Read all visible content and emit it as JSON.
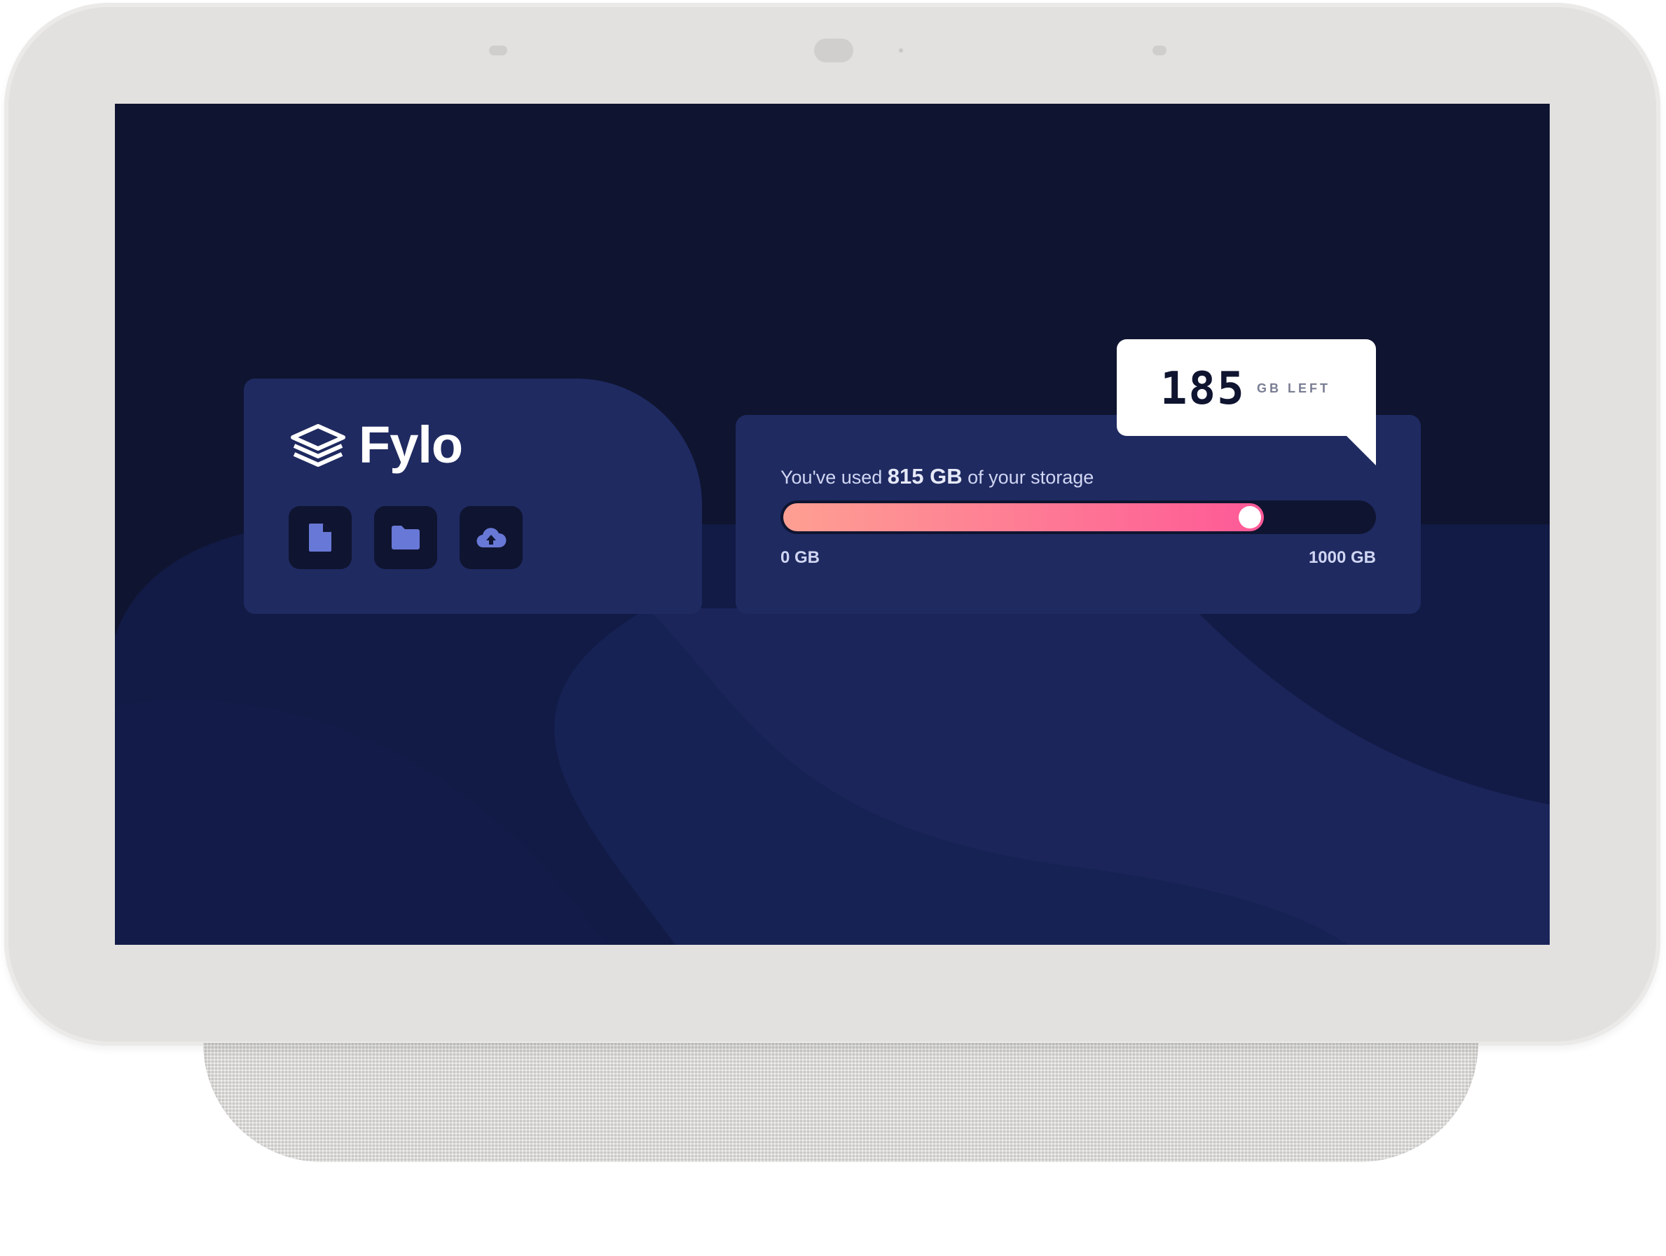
{
  "app": {
    "logo_text": "Fylo"
  },
  "toolbar": {
    "icons": [
      {
        "name": "document-icon"
      },
      {
        "name": "folder-icon"
      },
      {
        "name": "cloud-upload-icon"
      }
    ]
  },
  "storage": {
    "prefix": "You've used ",
    "used_amount": "815 GB",
    "suffix": " of your storage",
    "min_label": "0 GB",
    "max_label": "1000 GB",
    "remaining_value": "185",
    "remaining_unit": "GB LEFT",
    "used_fraction": 0.815
  },
  "colors": {
    "screen_bg": "#0f1430",
    "card_bg": "#1f2a61",
    "icon_fill": "#6878d6",
    "bar_start": "#fe9f92",
    "bar_end": "#fe5997",
    "text_light": "#d0d6f2"
  }
}
